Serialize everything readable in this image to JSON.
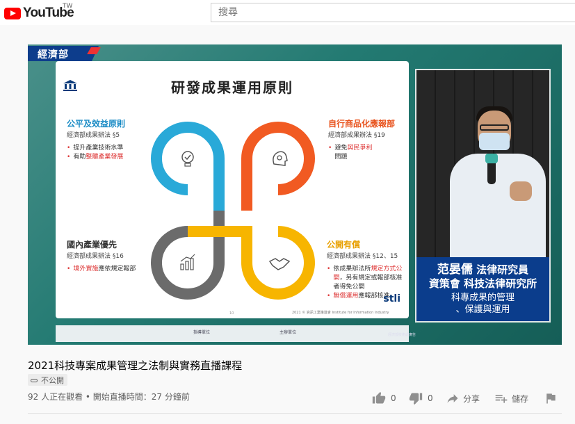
{
  "header": {
    "logo_text": "YouTube",
    "region": "TW",
    "search_placeholder": "搜尋"
  },
  "video": {
    "badge": "經濟部",
    "slide": {
      "title": "研發成果運用原則",
      "sections": [
        {
          "heading": "公平及效益原則",
          "law": "經濟部成果辦法 §5",
          "bullets": [
            {
              "text": "提升產業技術水準",
              "highlight": ""
            },
            {
              "text": "有助",
              "highlight": "整體產業發展"
            }
          ]
        },
        {
          "heading": "自行商品化應報部",
          "law": "經濟部成果辦法 §19",
          "bullets": [
            {
              "text": "避免",
              "highlight": "與民爭利",
              "extra": "問題"
            }
          ]
        },
        {
          "heading": "國內產業優先",
          "law": "經濟部成果辦法 §16",
          "bullets": [
            {
              "text": "應依規定報部",
              "highlight": "境外實施"
            }
          ]
        },
        {
          "heading": "公開有償",
          "law": "經濟部成果辦法 §12、15",
          "bullets": [
            {
              "text": "依成果辦法所",
              "highlight": "規定方式公開",
              "extra": "，另有規定或報部核准者得免公開"
            },
            {
              "text": "應報部核准",
              "highlight": "無償運用"
            }
          ]
        }
      ],
      "page_number": "10",
      "footer": "2021 © 資訊工業策進會 Institute for Information Industry",
      "brand": "stli"
    },
    "sponsors": {
      "organizer_label": "指導單位",
      "host_label": "主辦單位",
      "credit": "經濟部技術處廣告"
    },
    "speaker": {
      "name": "范晏儒",
      "title1": "法律研究員",
      "org1": "資策會",
      "org2": "科技法律研究所",
      "topic_line1": "科專成果的管理",
      "topic_line2": "、保護與運用"
    }
  },
  "info": {
    "title": "2021科技專案成果管理之法制與實務直播課程",
    "privacy": "不公開",
    "watching": "92 人正在觀看 • 開始直播時間：27 分鐘前",
    "likes": "0",
    "dislikes": "0",
    "share_label": "分享",
    "save_label": "儲存"
  },
  "colors": {
    "brand_red": "#ff0000",
    "player_teal": "#1d6e66",
    "caption_blue": "#0b3d8c",
    "loop_blue": "#29a9d8",
    "loop_orange": "#f15a22",
    "loop_gray": "#6b6b6b",
    "loop_yellow": "#f7b500"
  }
}
